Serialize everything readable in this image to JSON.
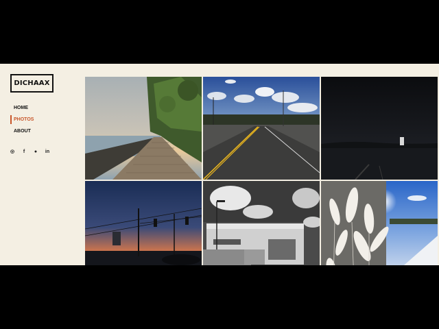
{
  "site": {
    "logo": "DICHAAX"
  },
  "nav": {
    "items": [
      {
        "label": "HOME"
      },
      {
        "label": "PHOTOS"
      },
      {
        "label": "ABOUT"
      }
    ],
    "active": "PHOTOS"
  },
  "socials": {
    "instagram": "◎",
    "facebook": "f",
    "github": "●",
    "linkedin": "in"
  },
  "colors": {
    "background": "#f4efe3",
    "accent": "#c8562a",
    "text": "#111111"
  },
  "gallery": {
    "photos": [
      {
        "subject": "boardwalk-by-the-lake-sunset"
      },
      {
        "subject": "road-under-blue-sky-with-clouds"
      },
      {
        "subject": "lake-at-night"
      },
      {
        "subject": "sunset-with-power-lines-and-traffic-lights"
      },
      {
        "subject": "black-and-white-building-with-clouds"
      },
      {
        "subject": "frosted-grass-in-snow"
      }
    ]
  }
}
